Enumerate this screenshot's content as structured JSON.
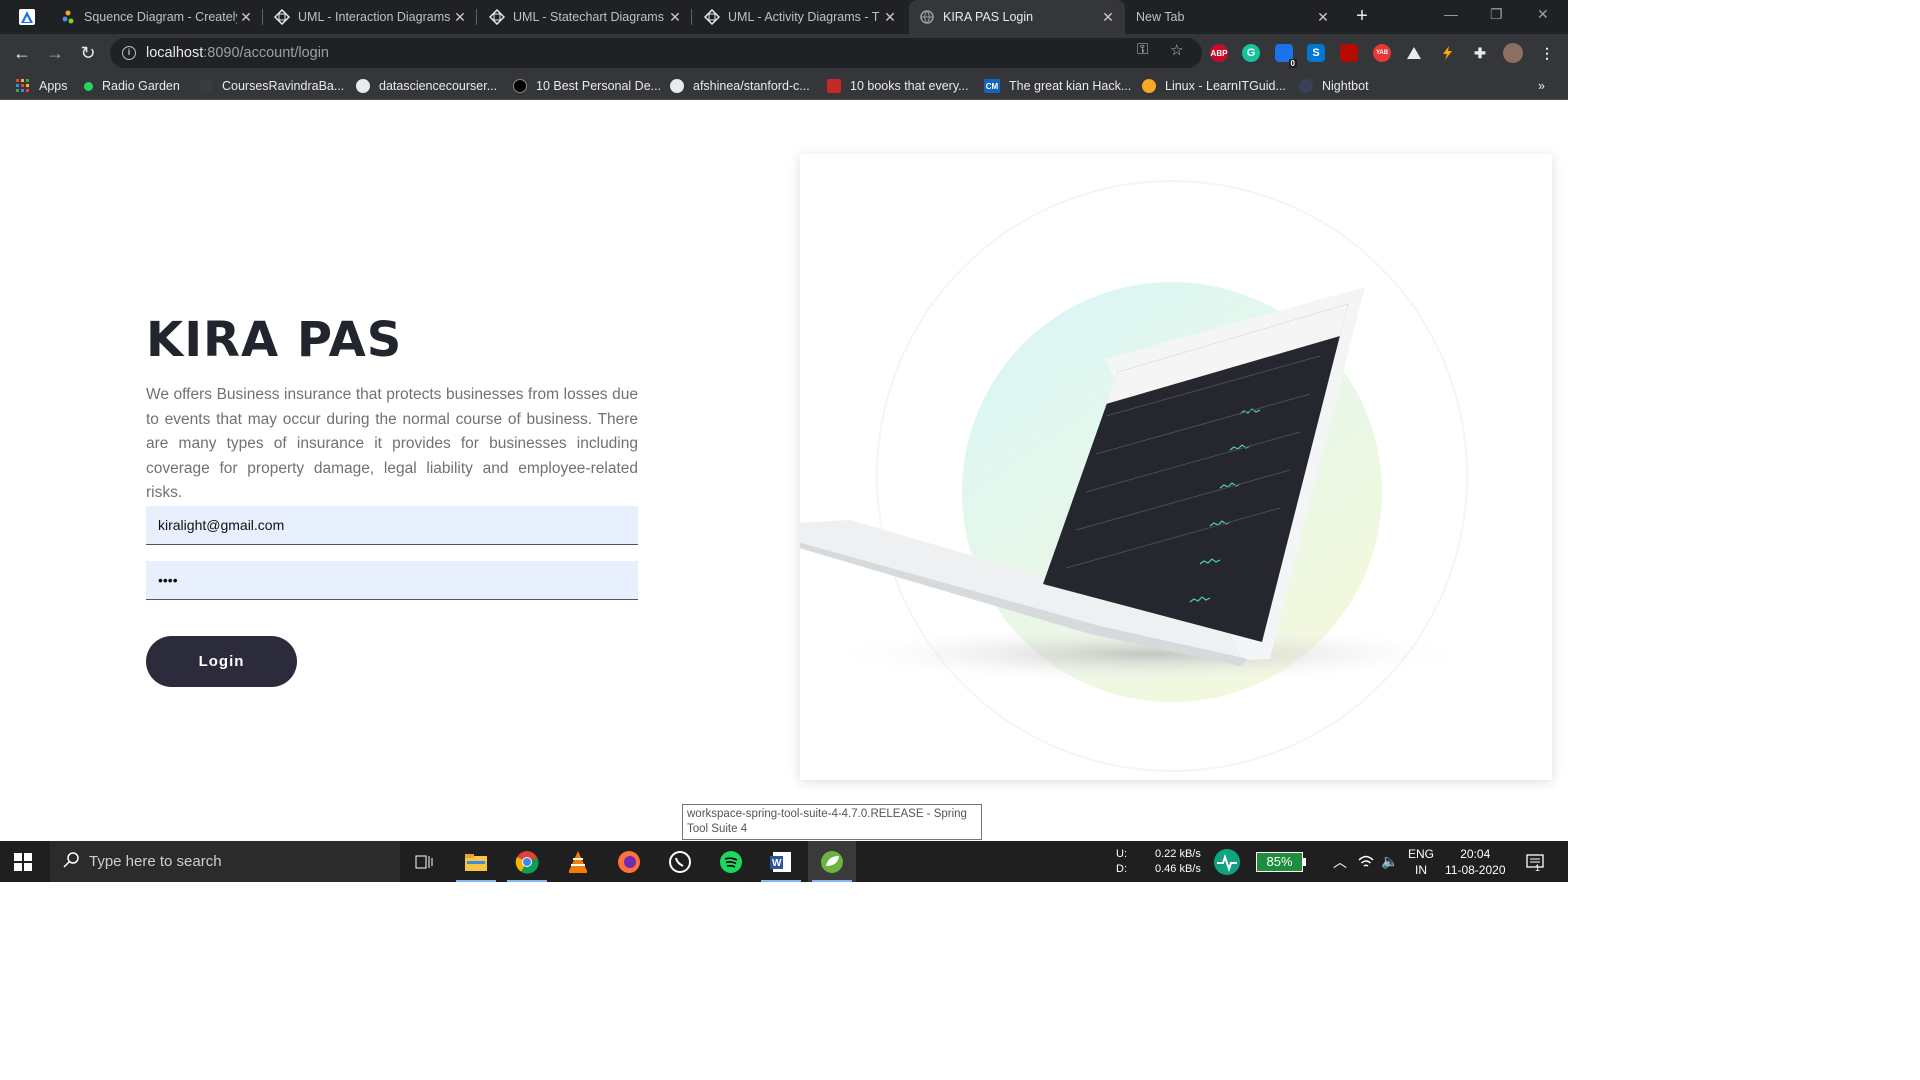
{
  "browser": {
    "tabs": [
      {
        "title": "Squence Diagram - Creately",
        "icon": "creately-icon"
      },
      {
        "title": "UML - Interaction Diagrams",
        "icon": "uml-icon"
      },
      {
        "title": "UML - Statechart Diagrams",
        "icon": "uml-icon"
      },
      {
        "title": "UML - Activity Diagrams - T",
        "icon": "uml-icon"
      },
      {
        "title": "KIRA PAS Login",
        "icon": "globe-icon",
        "active": true
      },
      {
        "title": "New Tab",
        "icon": ""
      }
    ],
    "address": {
      "host": "localhost",
      "rest": ":8090/account/login"
    },
    "extensions": [
      "ABP",
      "G",
      "0",
      "S",
      "",
      "YAB",
      "",
      "",
      "",
      ""
    ],
    "bookmarks": [
      {
        "label": "Apps"
      },
      {
        "label": "Radio Garden"
      },
      {
        "label": "CoursesRavindraBa..."
      },
      {
        "label": "datasciencecourser..."
      },
      {
        "label": "10 Best Personal De..."
      },
      {
        "label": "afshinea/stanford-c..."
      },
      {
        "label": "10 books that every..."
      },
      {
        "label": "The great kian Hack..."
      },
      {
        "label": "Linux - LearnITGuid..."
      },
      {
        "label": "Nightbot"
      }
    ],
    "more_bookmarks": "»"
  },
  "login_page": {
    "brand": "KIRA PAS",
    "description": "We offers Business insurance that protects businesses from losses due to events that may occur during the normal course of business. There are many types of insurance it provides for businesses including coverage for property damage, legal liability and employee-related risks.",
    "email_value": "kiralight@gmail.com",
    "password_value": "••••",
    "login_label": "Login"
  },
  "tooltip": "workspace-spring-tool-suite-4-4.7.0.RELEASE - Spring Tool Suite 4",
  "taskbar": {
    "search_placeholder": "Type here to search",
    "net_up_label": "U:",
    "net_down_label": "D:",
    "net_up": "0.22 kB/s",
    "net_down": "0.46 kB/s",
    "battery": "85%",
    "lang_1": "ENG",
    "lang_2": "IN",
    "time": "20:04",
    "date": "11-08-2020",
    "notif_count": "1"
  },
  "colors": {
    "button": "#2b2b3b",
    "field_bg": "#e8f0fe",
    "brand": "#22252e"
  }
}
